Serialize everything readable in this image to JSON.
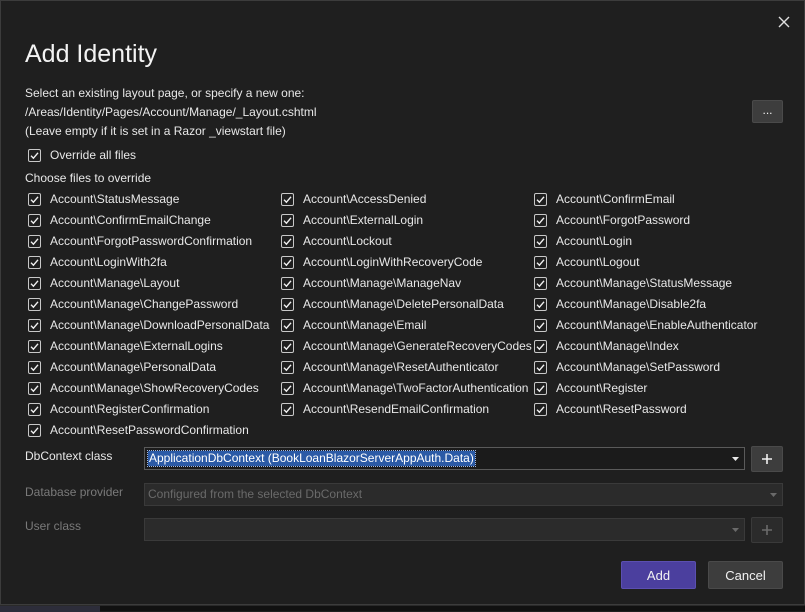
{
  "dialog": {
    "title": "Add Identity",
    "close_icon": "close-icon"
  },
  "layout_page": {
    "prompt": "Select an existing layout page, or specify a new one:",
    "path": "/Areas/Identity/Pages/Account/Manage/_Layout.cshtml",
    "hint": "(Leave empty if it is set in a Razor _viewstart file)",
    "browse_label": "..."
  },
  "override_all": {
    "label": "Override all files",
    "checked": true
  },
  "choose_files_label": "Choose files to override",
  "files": [
    [
      "Account\\StatusMessage",
      "Account\\AccessDenied",
      "Account\\ConfirmEmail"
    ],
    [
      "Account\\ConfirmEmailChange",
      "Account\\ExternalLogin",
      "Account\\ForgotPassword"
    ],
    [
      "Account\\ForgotPasswordConfirmation",
      "Account\\Lockout",
      "Account\\Login"
    ],
    [
      "Account\\LoginWith2fa",
      "Account\\LoginWithRecoveryCode",
      "Account\\Logout"
    ],
    [
      "Account\\Manage\\Layout",
      "Account\\Manage\\ManageNav",
      "Account\\Manage\\StatusMessage"
    ],
    [
      "Account\\Manage\\ChangePassword",
      "Account\\Manage\\DeletePersonalData",
      "Account\\Manage\\Disable2fa"
    ],
    [
      "Account\\Manage\\DownloadPersonalData",
      "Account\\Manage\\Email",
      "Account\\Manage\\EnableAuthenticator"
    ],
    [
      "Account\\Manage\\ExternalLogins",
      "Account\\Manage\\GenerateRecoveryCodes",
      "Account\\Manage\\Index"
    ],
    [
      "Account\\Manage\\PersonalData",
      "Account\\Manage\\ResetAuthenticator",
      "Account\\Manage\\SetPassword"
    ],
    [
      "Account\\Manage\\ShowRecoveryCodes",
      "Account\\Manage\\TwoFactorAuthentication",
      "Account\\Register"
    ],
    [
      "Account\\RegisterConfirmation",
      "Account\\ResendEmailConfirmation",
      "Account\\ResetPassword"
    ],
    [
      "Account\\ResetPasswordConfirmation"
    ]
  ],
  "dbcontext": {
    "label": "DbContext class",
    "value": "ApplicationDbContext (BookLoanBlazorServerAppAuth.Data)",
    "add_label": "+"
  },
  "database_provider": {
    "label": "Database provider",
    "value": "Configured from the selected DbContext"
  },
  "user_class": {
    "label": "User class",
    "value": "",
    "add_label": "+"
  },
  "actions": {
    "add_label": "Add",
    "cancel_label": "Cancel"
  },
  "colors": {
    "background": "#1f1f1f",
    "primary_button": "#4b3f9e",
    "selection": "#2b5aa6"
  }
}
